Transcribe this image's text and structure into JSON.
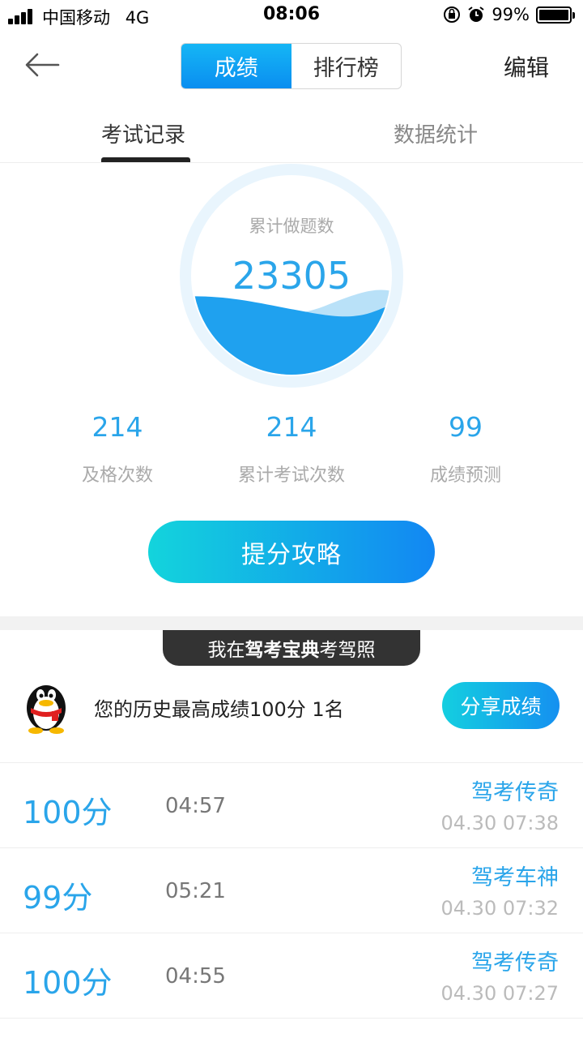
{
  "status_bar": {
    "carrier": "中国移动",
    "network": "4G",
    "time": "08:06",
    "battery": "99%"
  },
  "nav": {
    "segments": [
      "成绩",
      "排行榜"
    ],
    "active_segment": "成绩",
    "edit_label": "编辑"
  },
  "tabs": {
    "records_label": "考试记录",
    "stats_label": "数据统计",
    "active": "考试记录"
  },
  "summary": {
    "total_label": "累计做题数",
    "total_value": "23305",
    "stats": [
      {
        "value": "214",
        "label": "及格次数"
      },
      {
        "value": "214",
        "label": "累计考试次数"
      },
      {
        "value": "99",
        "label": "成绩预测"
      }
    ],
    "strategy_button": "提分攻略"
  },
  "promo": {
    "prefix": "我在",
    "brand": "驾考宝典",
    "suffix": "考驾照"
  },
  "best": {
    "text": "您的历史最高成绩100分 1名",
    "share_button": "分享成绩"
  },
  "records": [
    {
      "score": "100分",
      "duration": "04:57",
      "title": "驾考传奇",
      "date": "04.30 07:38"
    },
    {
      "score": "99分",
      "duration": "05:21",
      "title": "驾考车神",
      "date": "04.30 07:32"
    },
    {
      "score": "100分",
      "duration": "04:55",
      "title": "驾考传奇",
      "date": "04.30 07:27"
    }
  ],
  "colors": {
    "accent": "#2aa5ea",
    "segment_active": "#0a8ef0",
    "promo_bg": "#333333"
  }
}
